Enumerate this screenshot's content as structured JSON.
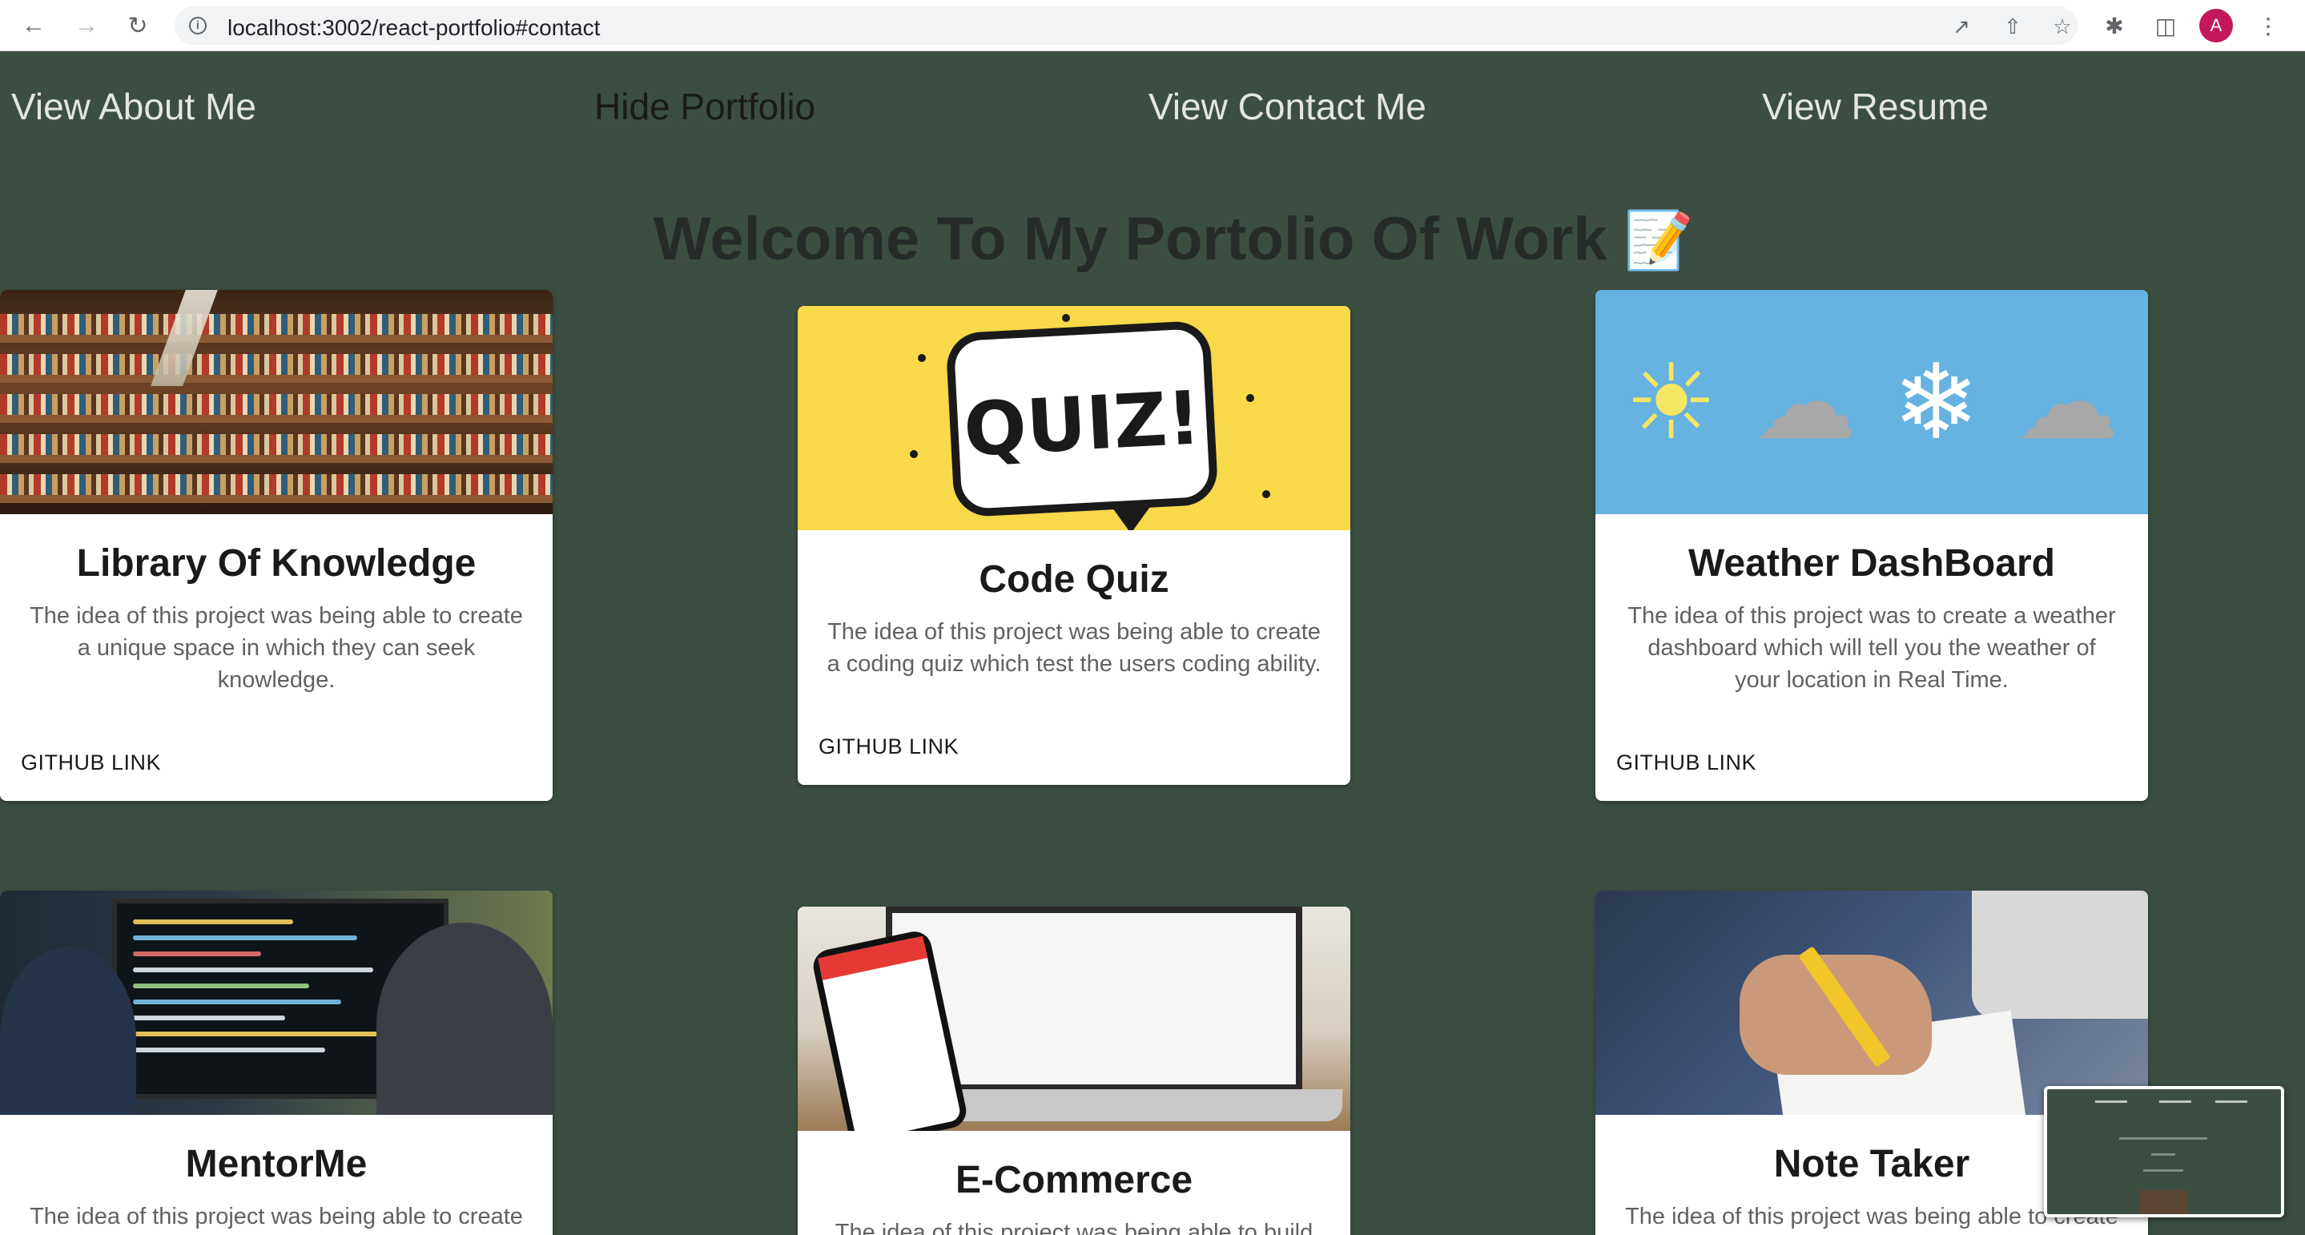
{
  "browser": {
    "url": "localhost:3002/react-portfolio#contact",
    "avatar_letter": "A"
  },
  "nav": {
    "items": [
      {
        "label": "View About Me",
        "active": false
      },
      {
        "label": "Hide Portfolio",
        "active": true
      },
      {
        "label": "View Contact Me",
        "active": false
      },
      {
        "label": "View Resume",
        "active": false
      }
    ]
  },
  "page": {
    "heading": "Welcome To My Portolio Of Work",
    "heading_emoji": "📝"
  },
  "cards": [
    {
      "title": "Library Of Knowledge",
      "description": "The idea of this project was being able to create a unique space in which they can seek knowledge.",
      "link": "GITHUB LINK"
    },
    {
      "title": "Code Quiz",
      "description": "The idea of this project was being able to create a coding quiz which test the users coding ability.",
      "link": "GITHUB LINK",
      "image_text": "QUIZ!"
    },
    {
      "title": "Weather DashBoard",
      "description": "The idea of this project was to create a weather dashboard which will tell you the weather of your location in Real Time.",
      "link": "GITHUB LINK"
    },
    {
      "title": "MentorMe",
      "description": "The idea of this project was being able to create"
    },
    {
      "title": "E-Commerce",
      "description": "The idea of this project was being able to build"
    },
    {
      "title": "Note Taker",
      "description": "The idea of this project was being able to create"
    }
  ],
  "colors": {
    "page_background": "#3c4e42",
    "nav_text": "#e5e5e5",
    "nav_active_text": "#1a1a1a",
    "card_background": "#ffffff",
    "avatar": "#c2185b"
  },
  "icons": [
    "back-icon",
    "forward-icon",
    "reload-icon",
    "info-icon",
    "open-in-new-icon",
    "share-icon",
    "star-icon",
    "extensions-icon",
    "side-panel-icon",
    "more-icon"
  ]
}
